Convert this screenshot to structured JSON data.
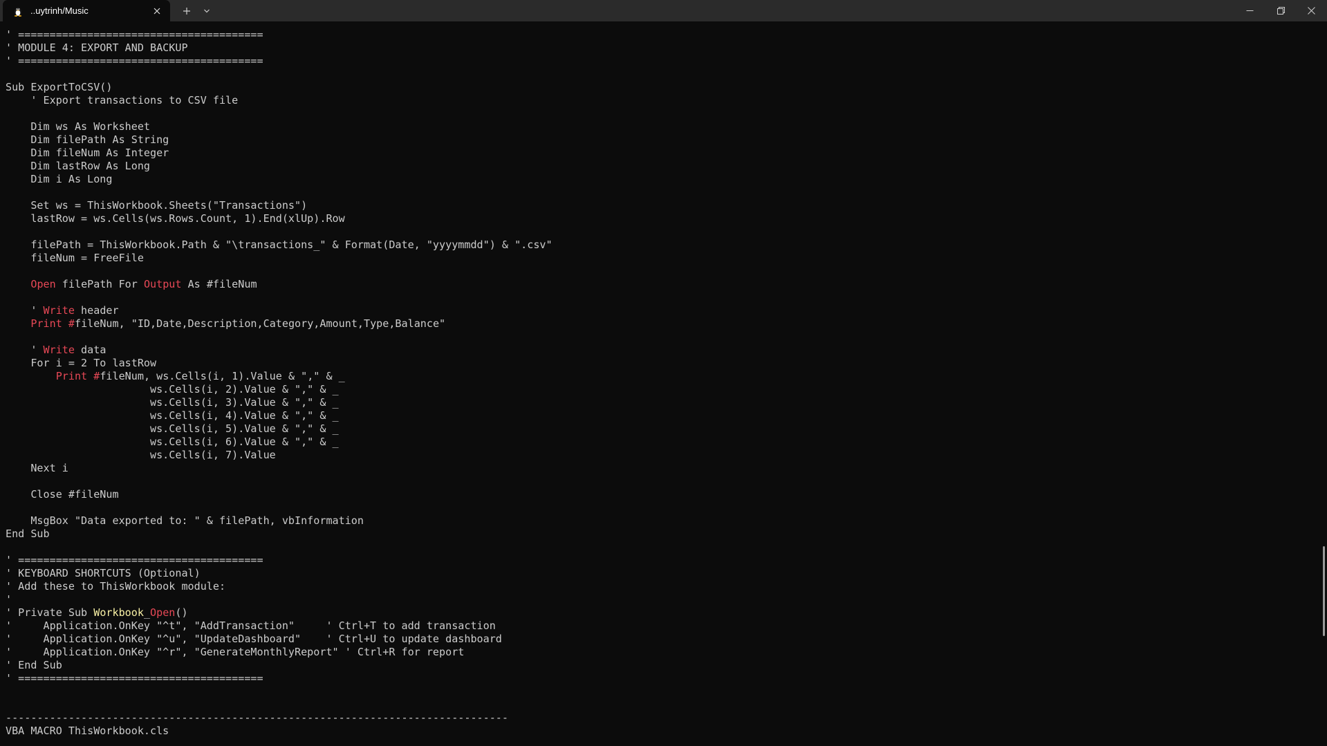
{
  "window": {
    "tab_title": "..uytrinh/Music",
    "tab_icon": "linux-penguin-icon",
    "new_tab_label": "+",
    "colors": {
      "background": "#0c0c0c",
      "titlebar": "#2b2b2b",
      "text": "#cccccc",
      "keyword": "#e74856",
      "highlight": "#f9f1a5"
    }
  },
  "terminal": {
    "lines": [
      [
        {
          "t": "' ======================================="
        }
      ],
      [
        {
          "t": "' MODULE 4: EXPORT AND BACKUP"
        }
      ],
      [
        {
          "t": "' ======================================="
        }
      ],
      [
        {
          "t": ""
        }
      ],
      [
        {
          "t": "Sub ExportToCSV()"
        }
      ],
      [
        {
          "t": "    ' Export transactions to CSV file"
        }
      ],
      [
        {
          "t": ""
        }
      ],
      [
        {
          "t": "    Dim ws As Worksheet"
        }
      ],
      [
        {
          "t": "    Dim filePath As String"
        }
      ],
      [
        {
          "t": "    Dim fileNum As Integer"
        }
      ],
      [
        {
          "t": "    Dim lastRow As Long"
        }
      ],
      [
        {
          "t": "    Dim i As Long"
        }
      ],
      [
        {
          "t": ""
        }
      ],
      [
        {
          "t": "    Set ws = ThisWorkbook.Sheets(\"Transactions\")"
        }
      ],
      [
        {
          "t": "    lastRow = ws.Cells(ws.Rows.Count, 1).End(xlUp).Row"
        }
      ],
      [
        {
          "t": ""
        }
      ],
      [
        {
          "t": "    filePath = ThisWorkbook.Path & \"\\transactions_\" & Format(Date, \"yyyymmdd\") & \".csv\""
        }
      ],
      [
        {
          "t": "    fileNum = FreeFile"
        }
      ],
      [
        {
          "t": ""
        }
      ],
      [
        {
          "t": "    "
        },
        {
          "t": "Open",
          "c": "kw"
        },
        {
          "t": " filePath For "
        },
        {
          "t": "Output",
          "c": "kw"
        },
        {
          "t": " As #fileNum"
        }
      ],
      [
        {
          "t": ""
        }
      ],
      [
        {
          "t": "    ' "
        },
        {
          "t": "Write",
          "c": "kw"
        },
        {
          "t": " header"
        }
      ],
      [
        {
          "t": "    "
        },
        {
          "t": "Print #",
          "c": "kw"
        },
        {
          "t": "fileNum, \"ID,Date,Description,Category,Amount,Type,Balance\""
        }
      ],
      [
        {
          "t": ""
        }
      ],
      [
        {
          "t": "    ' "
        },
        {
          "t": "Write",
          "c": "kw"
        },
        {
          "t": " data"
        }
      ],
      [
        {
          "t": "    For i = 2 To lastRow"
        }
      ],
      [
        {
          "t": "        "
        },
        {
          "t": "Print #",
          "c": "kw"
        },
        {
          "t": "fileNum, ws.Cells(i, 1).Value & \",\" & _"
        }
      ],
      [
        {
          "t": "                       ws.Cells(i, 2).Value & \",\" & _"
        }
      ],
      [
        {
          "t": "                       ws.Cells(i, 3).Value & \",\" & _"
        }
      ],
      [
        {
          "t": "                       ws.Cells(i, 4).Value & \",\" & _"
        }
      ],
      [
        {
          "t": "                       ws.Cells(i, 5).Value & \",\" & _"
        }
      ],
      [
        {
          "t": "                       ws.Cells(i, 6).Value & \",\" & _"
        }
      ],
      [
        {
          "t": "                       ws.Cells(i, 7).Value"
        }
      ],
      [
        {
          "t": "    Next i"
        }
      ],
      [
        {
          "t": ""
        }
      ],
      [
        {
          "t": "    Close #fileNum"
        }
      ],
      [
        {
          "t": ""
        }
      ],
      [
        {
          "t": "    MsgBox \"Data exported to: \" & filePath, vbInformation"
        }
      ],
      [
        {
          "t": "End Sub"
        }
      ],
      [
        {
          "t": ""
        }
      ],
      [
        {
          "t": "' ======================================="
        }
      ],
      [
        {
          "t": "' KEYBOARD SHORTCUTS (Optional)"
        }
      ],
      [
        {
          "t": "' Add these to ThisWorkbook module:"
        }
      ],
      [
        {
          "t": "'"
        }
      ],
      [
        {
          "t": "' Private Sub "
        },
        {
          "t": "Workbook",
          "c": "hl"
        },
        {
          "t": "_"
        },
        {
          "t": "Open",
          "c": "kw"
        },
        {
          "t": "()"
        }
      ],
      [
        {
          "t": "'     Application.OnKey \"^t\", \"AddTransaction\"     ' Ctrl+T to add transaction"
        }
      ],
      [
        {
          "t": "'     Application.OnKey \"^u\", \"UpdateDashboard\"    ' Ctrl+U to update dashboard"
        }
      ],
      [
        {
          "t": "'     Application.OnKey \"^r\", \"GenerateMonthlyReport\" ' Ctrl+R for report"
        }
      ],
      [
        {
          "t": "' End Sub"
        }
      ],
      [
        {
          "t": "' ======================================="
        }
      ],
      [
        {
          "t": ""
        }
      ],
      [
        {
          "t": ""
        }
      ],
      [
        {
          "t": "--------------------------------------------------------------------------------"
        }
      ],
      [
        {
          "t": "VBA MACRO ThisWorkbook.cls"
        }
      ]
    ]
  }
}
